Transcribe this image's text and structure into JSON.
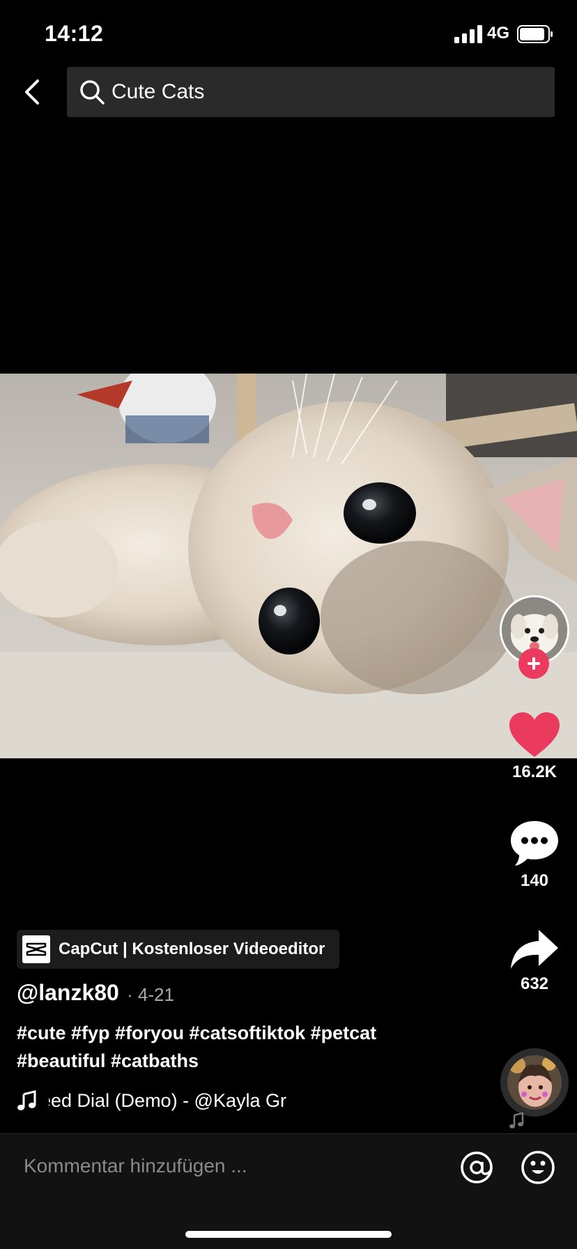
{
  "status_bar": {
    "time": "14:12",
    "network": "4G",
    "signal_icon": "signal-bars-icon",
    "battery_icon": "battery-icon"
  },
  "search": {
    "query": "Cute Cats",
    "back_icon": "chevron-left-icon",
    "search_icon": "magnifier-icon"
  },
  "video": {
    "thumbnail_icon": "kitten-photo"
  },
  "actions": {
    "likes": "16.2K",
    "comments": "140",
    "shares": "632",
    "like_color": "#ea3a5e",
    "follow_color": "#ea3a5e"
  },
  "post": {
    "app_badge": "CapCut | Kostenloser Videoeditor",
    "username": "@lanzk80",
    "date": "· 4-21",
    "caption": "#cute #fyp #foryou #catsoftiktok #petcat #beautiful #catbaths",
    "music": "eed Dial (Demo) - @Kayla Gr"
  },
  "comment_bar": {
    "placeholder": "Kommentar hinzufügen ...",
    "mention_icon": "at-sign-icon",
    "emoji_icon": "smiley-icon"
  }
}
